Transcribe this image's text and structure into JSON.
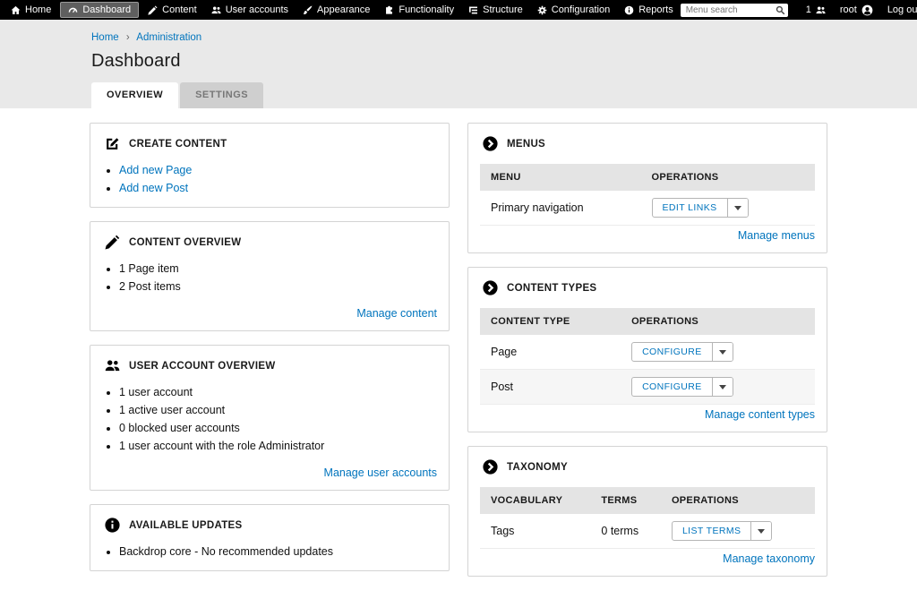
{
  "admin_bar": {
    "items": [
      {
        "label": "Home",
        "icon": "home-icon"
      },
      {
        "label": "Dashboard",
        "icon": "dashboard-icon",
        "active": true
      },
      {
        "label": "Content",
        "icon": "pencil-icon"
      },
      {
        "label": "User accounts",
        "icon": "users-icon"
      },
      {
        "label": "Appearance",
        "icon": "brush-icon"
      },
      {
        "label": "Functionality",
        "icon": "puzzle-icon"
      },
      {
        "label": "Structure",
        "icon": "structure-icon"
      },
      {
        "label": "Configuration",
        "icon": "gear-icon"
      },
      {
        "label": "Reports",
        "icon": "info-icon"
      }
    ],
    "search_placeholder": "Menu search",
    "user_count": "1",
    "username": "root",
    "logout_label": "Log out"
  },
  "breadcrumb": {
    "items": [
      "Home",
      "Administration"
    ],
    "separator": "›"
  },
  "page": {
    "title": "Dashboard"
  },
  "tabs": [
    {
      "label": "OVERVIEW",
      "active": true
    },
    {
      "label": "SETTINGS",
      "active": false
    }
  ],
  "cards": {
    "create_content": {
      "title": "CREATE CONTENT",
      "links": [
        "Add new Page",
        "Add new Post"
      ]
    },
    "content_overview": {
      "title": "CONTENT OVERVIEW",
      "items": [
        "1 Page item",
        "2 Post items"
      ],
      "manage_link": "Manage content"
    },
    "user_overview": {
      "title": "USER ACCOUNT OVERVIEW",
      "items": [
        "1 user account",
        "1 active user account",
        "0 blocked user accounts",
        "1 user account with the role Administrator"
      ],
      "manage_link": "Manage user accounts"
    },
    "updates": {
      "title": "AVAILABLE UPDATES",
      "items": [
        "Backdrop core - No recommended updates"
      ]
    },
    "menus": {
      "title": "MENUS",
      "columns": [
        "MENU",
        "OPERATIONS"
      ],
      "rows": [
        {
          "name": "Primary navigation",
          "action": "EDIT LINKS"
        }
      ],
      "manage_link": "Manage menus"
    },
    "content_types": {
      "title": "CONTENT TYPES",
      "columns": [
        "CONTENT TYPE",
        "OPERATIONS"
      ],
      "rows": [
        {
          "name": "Page",
          "action": "CONFIGURE"
        },
        {
          "name": "Post",
          "action": "CONFIGURE"
        }
      ],
      "manage_link": "Manage content types"
    },
    "taxonomy": {
      "title": "TAXONOMY",
      "columns": [
        "VOCABULARY",
        "TERMS",
        "OPERATIONS"
      ],
      "rows": [
        {
          "name": "Tags",
          "terms": "0 terms",
          "action": "LIST TERMS"
        }
      ],
      "manage_link": "Manage taxonomy"
    }
  },
  "colors": {
    "link": "#0074bd",
    "bar": "#000000",
    "header_bg": "#e9e9e9"
  }
}
